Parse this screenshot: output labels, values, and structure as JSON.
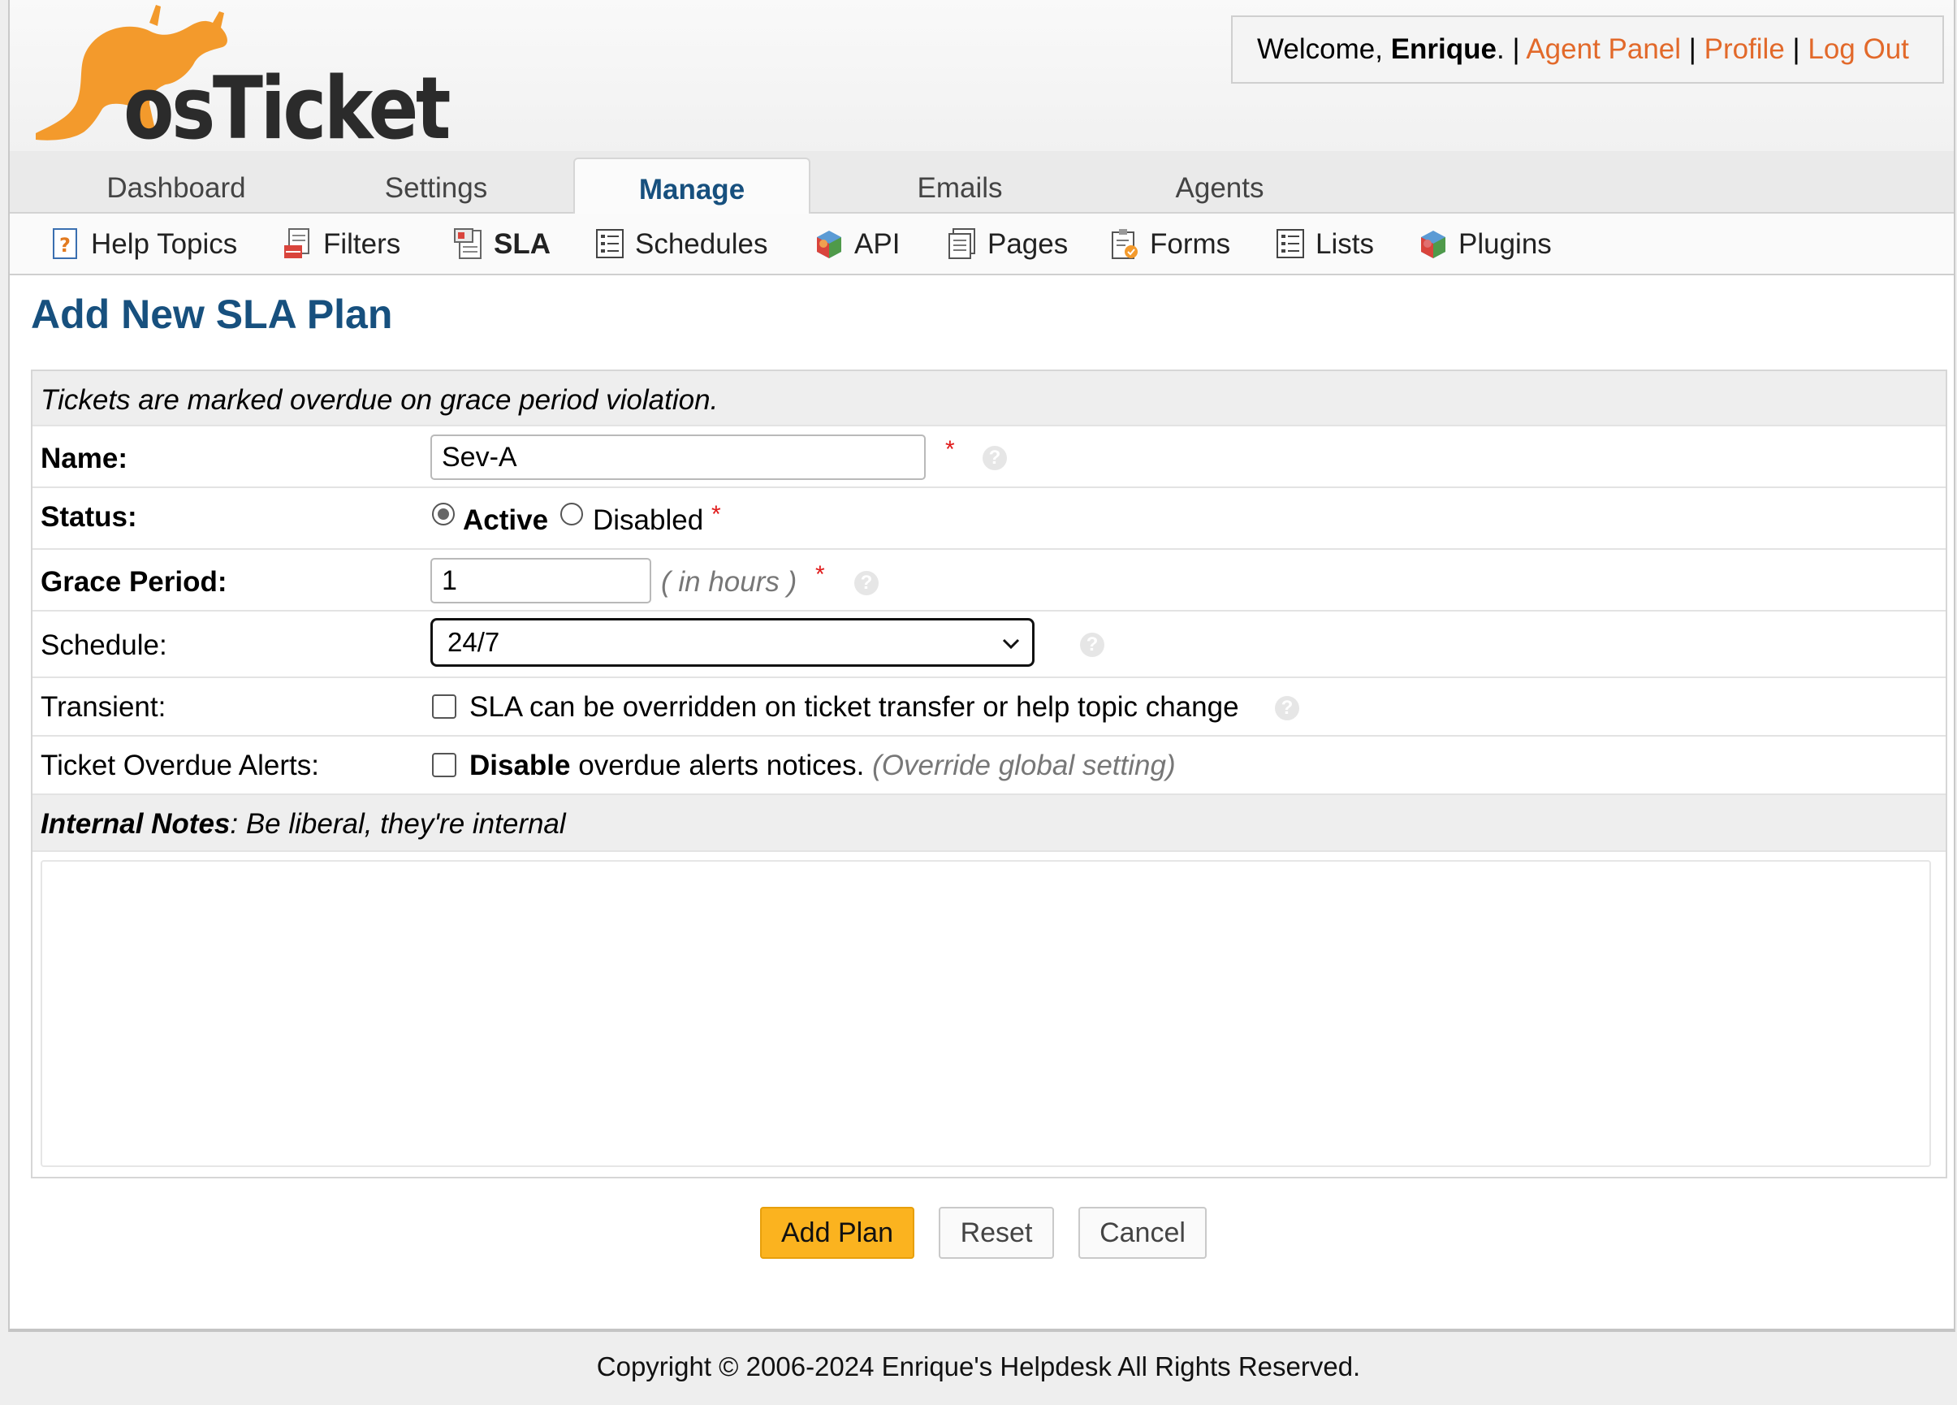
{
  "header": {
    "logo_text": "osTicket",
    "welcome_prefix": "Welcome, ",
    "user_name": "Enrique",
    "welcome_suffix": ".",
    "separator": " | ",
    "links": [
      "Agent Panel",
      "Profile",
      "Log Out"
    ],
    "link_color": "#e2692a"
  },
  "nav": {
    "tabs": [
      {
        "label": "Dashboard",
        "active": false
      },
      {
        "label": "Settings",
        "active": false
      },
      {
        "label": "Manage",
        "active": true
      },
      {
        "label": "Emails",
        "active": false
      },
      {
        "label": "Agents",
        "active": false
      }
    ]
  },
  "subnav": {
    "items": [
      {
        "label": "Help Topics",
        "icon": "help-topics-icon",
        "active": false
      },
      {
        "label": "Filters",
        "icon": "filters-icon",
        "active": false
      },
      {
        "label": "SLA",
        "icon": "sla-icon",
        "active": true
      },
      {
        "label": "Schedules",
        "icon": "schedules-icon",
        "active": false
      },
      {
        "label": "API",
        "icon": "api-icon",
        "active": false
      },
      {
        "label": "Pages",
        "icon": "pages-icon",
        "active": false
      },
      {
        "label": "Forms",
        "icon": "forms-icon",
        "active": false
      },
      {
        "label": "Lists",
        "icon": "lists-icon",
        "active": false
      },
      {
        "label": "Plugins",
        "icon": "plugins-icon",
        "active": false
      }
    ]
  },
  "page": {
    "title": "Add New SLA Plan",
    "title_color": "#17507e"
  },
  "form": {
    "intro": "Tickets are marked overdue on grace period violation.",
    "name": {
      "label": "Name:",
      "value": "Sev-A",
      "required": "*"
    },
    "status": {
      "label": "Status:",
      "options": [
        "Active",
        "Disabled"
      ],
      "selected": "Active",
      "required": "*"
    },
    "grace": {
      "label": "Grace Period:",
      "value": "1",
      "unit": "( in hours )",
      "required": "*"
    },
    "schedule": {
      "label": "Schedule:",
      "selected": "24/7"
    },
    "transient": {
      "label": "Transient:",
      "checkbox_label": "SLA can be overridden on ticket transfer or help topic change",
      "checked": false
    },
    "overdue": {
      "label": "Ticket Overdue Alerts:",
      "bold": "Disable",
      "text": " overdue alerts notices.",
      "note": "(Override global setting)",
      "checked": false
    },
    "notes": {
      "title": "Internal Notes",
      "hint": ": Be liberal, they're internal",
      "value": ""
    }
  },
  "buttons": {
    "submit": "Add Plan",
    "reset": "Reset",
    "cancel": "Cancel"
  },
  "footer": {
    "copyright": "Copyright © 2006-2024 Enrique's Helpdesk All Rights Reserved."
  }
}
